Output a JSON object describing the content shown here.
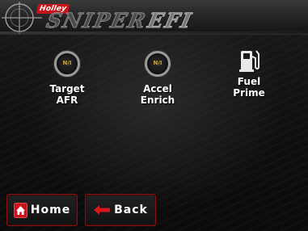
{
  "header": {
    "brand": "Holley",
    "logo_main": "SNIPER",
    "logo_suffix": "EFI"
  },
  "menu": {
    "items": [
      {
        "label_line1": "Target",
        "label_line2": "AFR",
        "icon": "gauge-icon",
        "icon_text": "N/I"
      },
      {
        "label_line1": "Accel",
        "label_line2": "Enrich",
        "icon": "gauge-icon",
        "icon_text": "N/I"
      },
      {
        "label_line1": "Fuel",
        "label_line2": "Prime",
        "icon": "fuel-pump-icon"
      }
    ]
  },
  "footer": {
    "home_label": "Home",
    "back_label": "Back"
  },
  "colors": {
    "accent": "#c8151b",
    "button_border": "#8a1012",
    "background": "#0c0c0c"
  }
}
